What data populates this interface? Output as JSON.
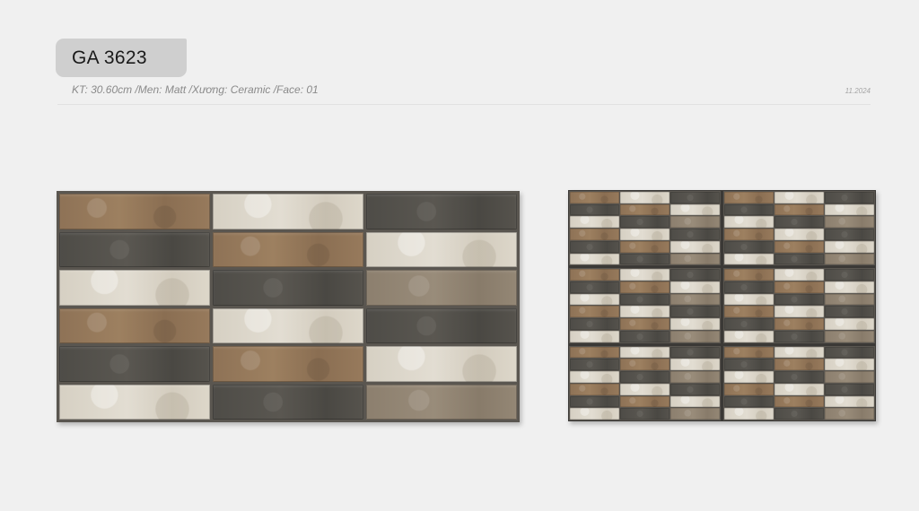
{
  "header": {
    "product_code": "GA 3623",
    "specs": "KT: 30.60cm /Men: Matt /Xương: Ceramic /Face: 01",
    "date": "11.2024"
  },
  "tile_pattern": [
    [
      "brown",
      "cream",
      "dark"
    ],
    [
      "dark",
      "brown",
      "cream"
    ],
    [
      "cream",
      "dark",
      "taupe"
    ],
    [
      "brown",
      "cream",
      "dark"
    ],
    [
      "dark",
      "brown",
      "cream"
    ],
    [
      "cream",
      "dark",
      "taupe"
    ]
  ],
  "wall_layout": {
    "columns": 2,
    "rows": 3
  },
  "colors": {
    "background": "#f0f0f0",
    "badge": "#cfcfcf",
    "grout": "#5a5650",
    "brown": "#977a5c",
    "cream": "#ddd7ca",
    "dark": "#56534d",
    "taupe": "#948775"
  }
}
